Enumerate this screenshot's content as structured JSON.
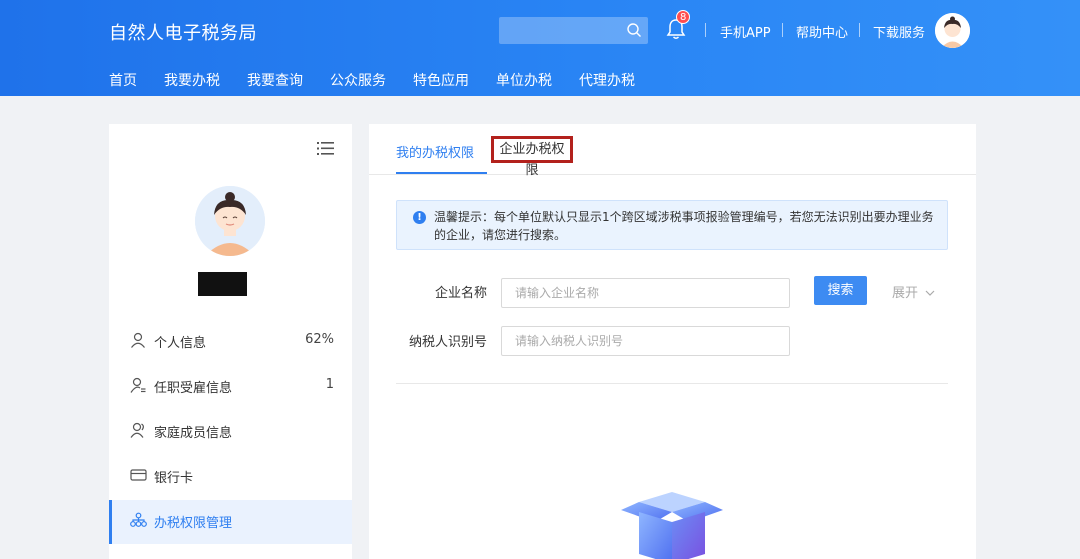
{
  "header": {
    "brand": "自然人电子税务局",
    "search_placeholder": "",
    "notification_count": "8",
    "links": [
      "手机APP",
      "帮助中心",
      "下载服务"
    ],
    "nav": [
      "首页",
      "我要办税",
      "我要查询",
      "公众服务",
      "特色应用",
      "单位办税",
      "代理办税"
    ]
  },
  "sidebar": {
    "items": [
      {
        "label": "个人信息",
        "value": "62%",
        "icon": "user-icon"
      },
      {
        "label": "任职受雇信息",
        "value": "1",
        "icon": "employment-icon"
      },
      {
        "label": "家庭成员信息",
        "value": "",
        "icon": "family-icon"
      },
      {
        "label": "银行卡",
        "value": "",
        "icon": "bank-card-icon"
      },
      {
        "label": "办税权限管理",
        "value": "",
        "icon": "permission-icon",
        "active": true
      }
    ]
  },
  "main": {
    "tabs": [
      {
        "label": "我的办税权限",
        "active": true
      },
      {
        "label": "企业办税权限",
        "active": false
      }
    ],
    "notice": "温馨提示：每个单位默认只显示1个跨区域涉税事项报验管理编号，若您无法识别出要办理业务的企业，请您进行搜索。",
    "form": {
      "company_label": "企业名称",
      "company_placeholder": "请输入企业名称",
      "taxid_label": "纳税人识别号",
      "taxid_placeholder": "请输入纳税人识别号",
      "search_label": "搜索",
      "expand_label": "展开"
    }
  },
  "colors": {
    "brand_blue": "#2a86f5",
    "accent": "#2f7ff0",
    "highlight_border": "#b3211c"
  }
}
